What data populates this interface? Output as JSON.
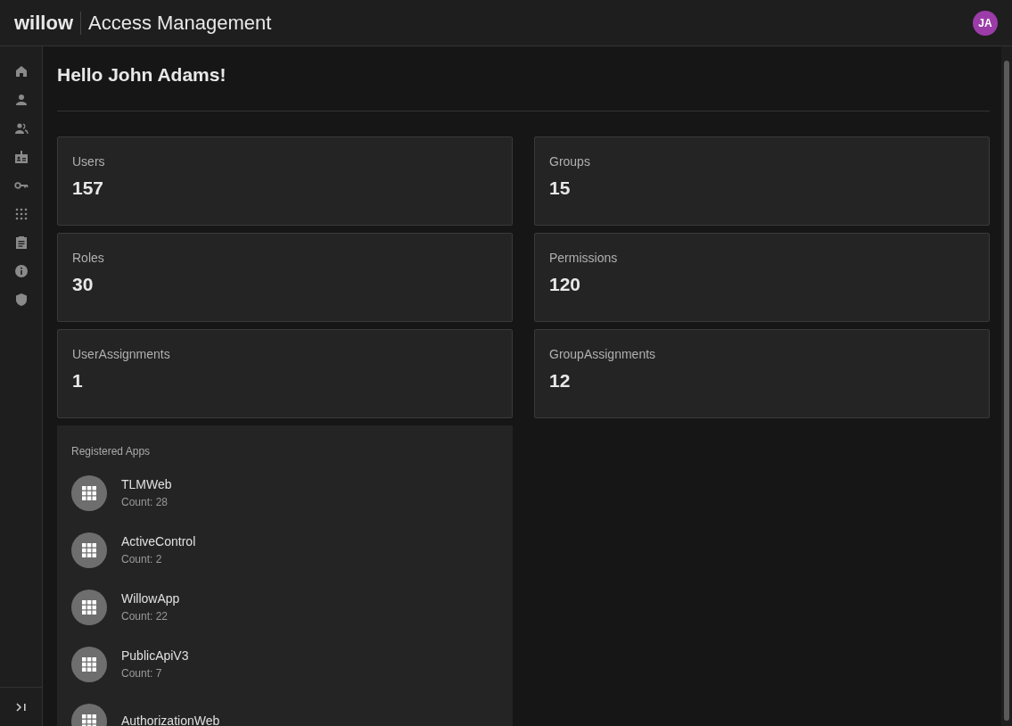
{
  "header": {
    "logo": "willow",
    "title": "Access Management",
    "avatar": "JA"
  },
  "greeting": "Hello John Adams!",
  "stats": [
    {
      "label": "Users",
      "value": "157"
    },
    {
      "label": "Groups",
      "value": "15"
    },
    {
      "label": "Roles",
      "value": "30"
    },
    {
      "label": "Permissions",
      "value": "120"
    },
    {
      "label": "UserAssignments",
      "value": "1"
    },
    {
      "label": "GroupAssignments",
      "value": "12"
    }
  ],
  "registered_apps": {
    "title": "Registered Apps",
    "apps": [
      {
        "name": "TLMWeb",
        "count": "Count: 28"
      },
      {
        "name": "ActiveControl",
        "count": "Count: 2"
      },
      {
        "name": "WillowApp",
        "count": "Count: 22"
      },
      {
        "name": "PublicApiV3",
        "count": "Count: 7"
      },
      {
        "name": "AuthorizationWeb"
      }
    ]
  }
}
